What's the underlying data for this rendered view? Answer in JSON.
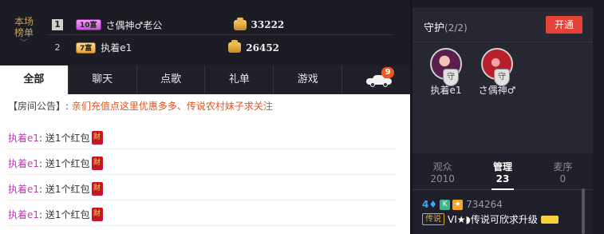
{
  "rank": {
    "label_line1": "本场",
    "label_line2": "榜单",
    "chevron": "﹀",
    "rows": [
      {
        "num": "1",
        "level": "10富",
        "name": "さ偶神♂老公",
        "score": "33222"
      },
      {
        "num": "2",
        "level": "7富",
        "name": "执着e1",
        "score": "26452"
      }
    ]
  },
  "tabs": [
    "全部",
    "聊天",
    "点歌",
    "礼单",
    "游戏"
  ],
  "car_tab": {
    "icon": "car-icon",
    "badge": "9"
  },
  "notice": {
    "prefix": "【房间公告】:",
    "text": "亲们充值点这里优惠多多、传说农村妹子求关注"
  },
  "messages": [
    {
      "user": "执着e1",
      "text": ": 送1个红包",
      "icon": "财"
    },
    {
      "user": "执着e1",
      "text": ": 送1个红包",
      "icon": "财"
    },
    {
      "user": "执着e1",
      "text": ": 送1个红包",
      "icon": "财"
    },
    {
      "user": "执着e1",
      "text": ": 送1个红包",
      "icon": "财"
    }
  ],
  "guard": {
    "title": "守护",
    "count": "(2/2)",
    "open_label": "开通",
    "avatars": [
      {
        "name": "执着e1",
        "icon": "shield-icon",
        "shield_text": "守"
      },
      {
        "name": "さ偶神♂",
        "icon": "shield-icon",
        "shield_text": "守"
      }
    ]
  },
  "user_tabs": [
    {
      "label": "观众",
      "count": "2010"
    },
    {
      "label": "管理",
      "count": "23"
    },
    {
      "label": "麦序",
      "count": "0"
    }
  ],
  "user_entry": {
    "level": "4",
    "diamond_icon": "diamond-icon",
    "k_badge": "K",
    "star_badge": "★",
    "id": "734264",
    "tag": "传说",
    "name": "VI★◗传说可欣求升级"
  },
  "colors": {
    "accent_red": "#e74238",
    "chat_user": "#b83fb0",
    "notice_text": "#e5531f"
  }
}
